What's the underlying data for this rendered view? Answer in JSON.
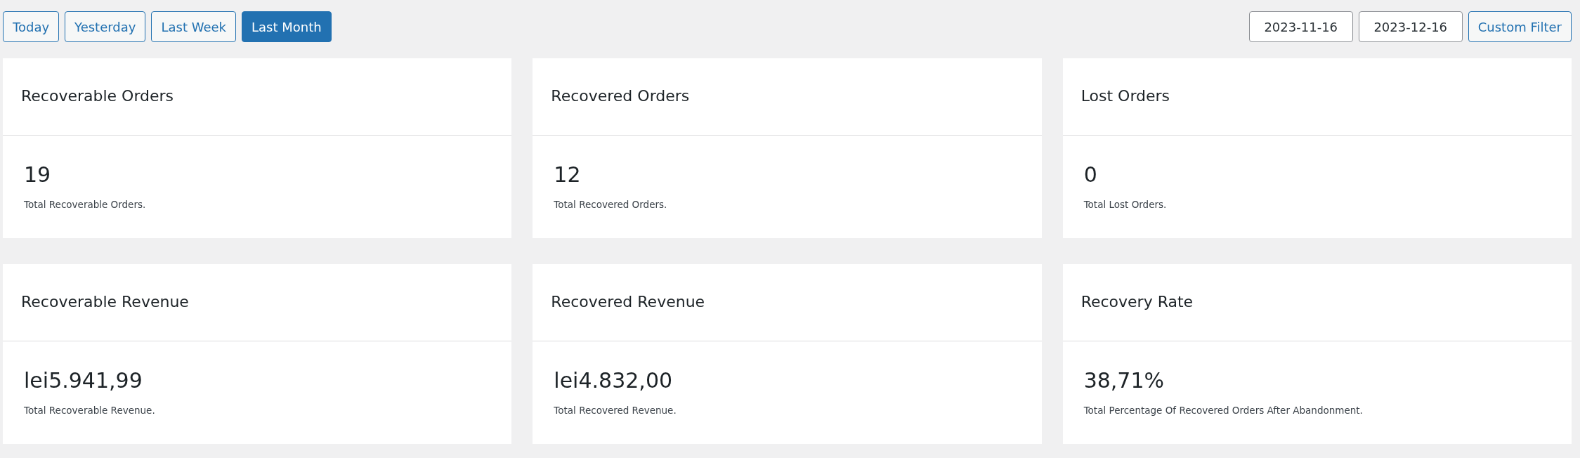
{
  "range_buttons": [
    {
      "label": "Today",
      "selected": false
    },
    {
      "label": "Yesterday",
      "selected": false
    },
    {
      "label": "Last Week",
      "selected": false
    },
    {
      "label": "Last Month",
      "selected": true
    }
  ],
  "custom_filter": {
    "start_date": "2023-11-16",
    "end_date": "2023-12-16",
    "button": "Custom Filter"
  },
  "cards": [
    {
      "title": "Recoverable Orders",
      "value": "19",
      "description": "Total Recoverable Orders."
    },
    {
      "title": "Recovered Orders",
      "value": "12",
      "description": "Total Recovered Orders."
    },
    {
      "title": "Lost Orders",
      "value": "0",
      "description": "Total Lost Orders."
    },
    {
      "title": "Recoverable Revenue",
      "value": "lei5.941,99",
      "description": "Total Recoverable Revenue."
    },
    {
      "title": "Recovered Revenue",
      "value": "lei4.832,00",
      "description": "Total Recovered Revenue."
    },
    {
      "title": "Recovery Rate",
      "value": "38,71%",
      "description": "Total Percentage Of Recovered Orders After Abandonment."
    }
  ]
}
